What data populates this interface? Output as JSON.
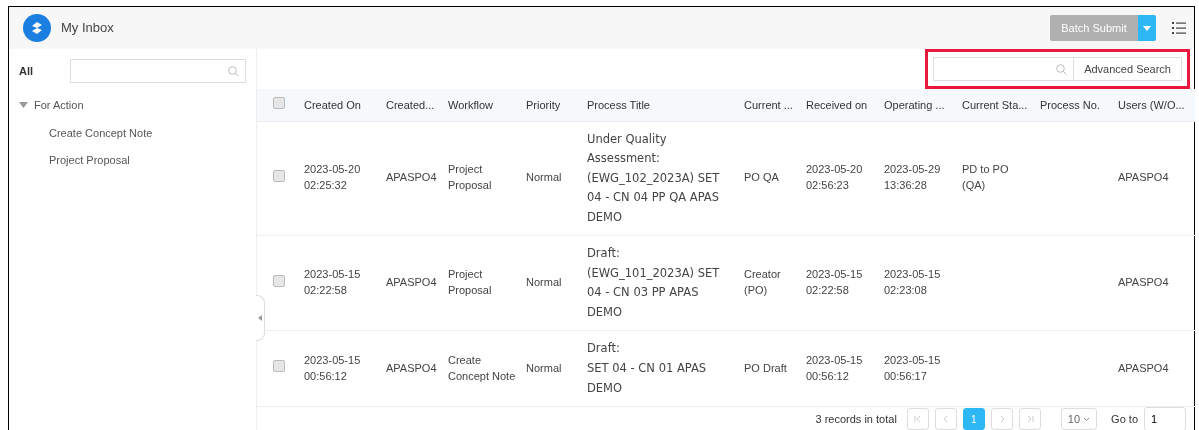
{
  "header": {
    "title": "My Inbox",
    "batch_button": {
      "label": "Batch Submit",
      "disabled": true
    }
  },
  "sidebar": {
    "filter_label": "All",
    "tree": [
      {
        "label": "For Action",
        "expanded": true,
        "children": [
          {
            "label": "Create Concept Note"
          },
          {
            "label": "Project Proposal"
          }
        ]
      }
    ]
  },
  "toolbar": {
    "advanced_search": "Advanced Search",
    "highlighted": true
  },
  "table": {
    "select_all_checked": false,
    "columns": [
      "Created On",
      "Created...",
      "Workflow",
      "Priority",
      "Process Title",
      "Current ...",
      "Received on",
      "Operating ...",
      "Current Sta...",
      "Process No.",
      "Users (W/O..."
    ],
    "rows": [
      {
        "checked": false,
        "cells": [
          "2023-05-20 02:25:32",
          "APASPO4",
          "Project Proposal",
          "Normal",
          "Under Quality Assessment:\n(EWG_102_2023A) SET 04 - CN 04 PP QA APAS DEMO",
          "PO QA",
          "2023-05-20 02:56:23",
          "2023-05-29 13:36:28",
          "PD to  PO (QA)",
          "",
          "APASPO4"
        ]
      },
      {
        "checked": false,
        "cells": [
          "2023-05-15 02:22:58",
          "APASPO4",
          "Project Proposal",
          "Normal",
          "Draft:\n(EWG_101_2023A) SET 04 - CN 03 PP APAS DEMO",
          "Creator (PO)",
          "2023-05-15 02:22:58",
          "2023-05-15 02:23:08",
          "",
          "",
          "APASPO4"
        ]
      },
      {
        "checked": false,
        "cells": [
          "2023-05-15 00:56:12",
          "APASPO4",
          "Create Concept Note",
          "Normal",
          "Draft:\nSET 04 - CN 01 APAS DEMO",
          "PO Draft",
          "2023-05-15 00:56:12",
          "2023-05-15 00:56:17",
          "",
          "",
          "APASPO4"
        ]
      }
    ]
  },
  "pager": {
    "total": "3 records in total",
    "pages": [
      {
        "label": "1",
        "selected": true
      }
    ],
    "page_size": "10",
    "goto_label": "Go to",
    "goto_value": "1"
  }
}
